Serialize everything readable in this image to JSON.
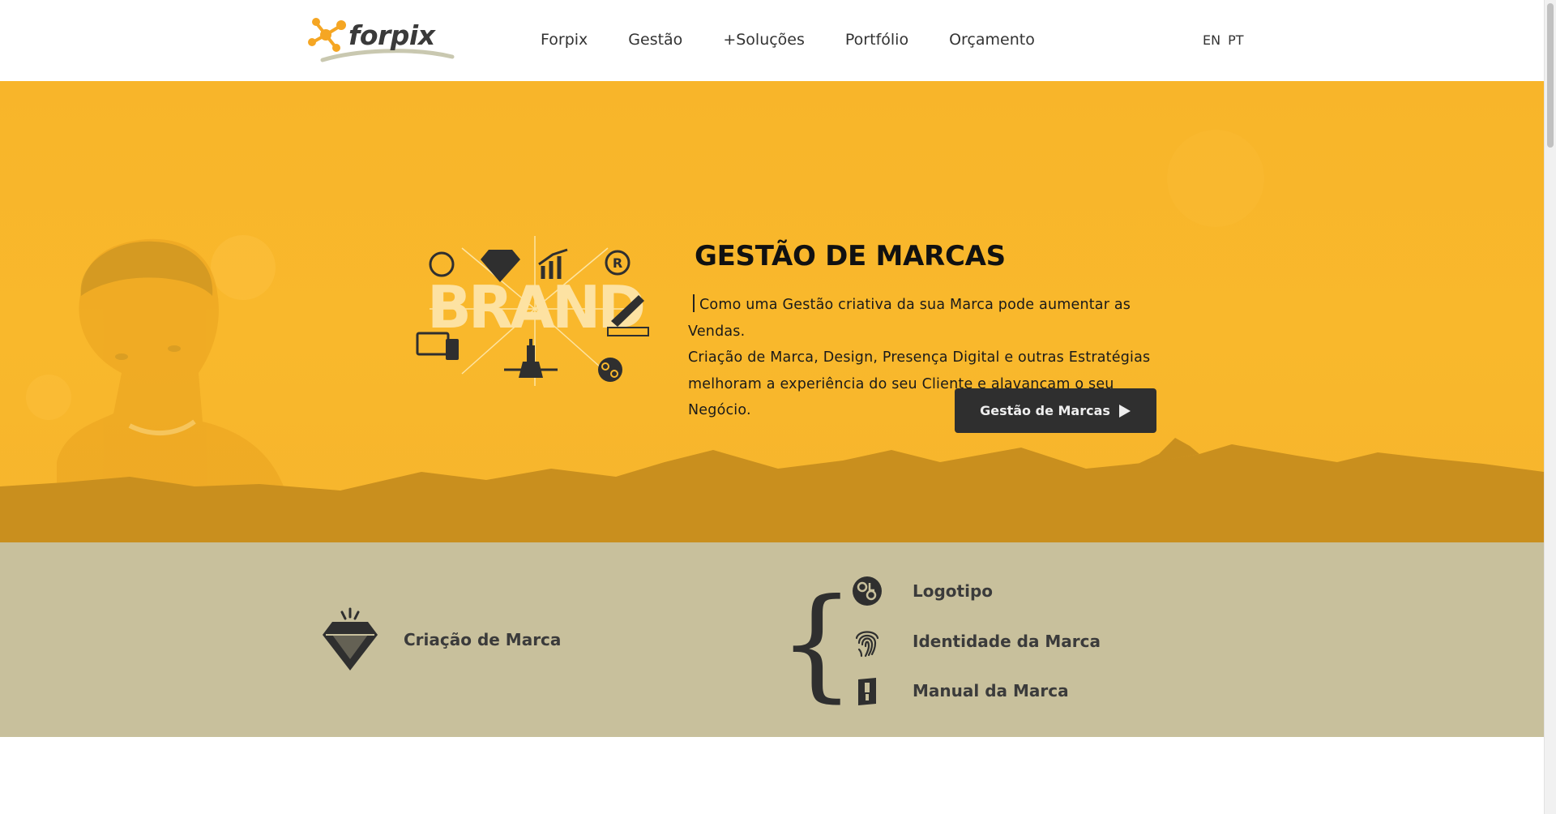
{
  "header": {
    "logo_text": "forpix",
    "nav": [
      "Forpix",
      "Gestão",
      "+Soluções",
      "Portfólio",
      "Orçamento"
    ],
    "languages": [
      "EN",
      "PT"
    ]
  },
  "hero": {
    "art_text": "BRAND",
    "title": "GESTÃO DE MARCAS",
    "description_line1": "Como uma Gestão criativa da sua Marca pode aumentar as Vendas.",
    "description_line2": "Criação de Marca, Design, Presença Digital e outras Estratégias",
    "description_line3": "melhoram a experiência do seu Cliente e alavancam o seu Negócio.",
    "button_label": "Gestão de Marcas"
  },
  "services": {
    "main": "Criação de Marca",
    "sub": [
      "Logotipo",
      "Identidade da Marca",
      "Manual da Marca"
    ]
  },
  "colors": {
    "hero_yellow": "#f9b82c",
    "band_khaki": "#c8c09c",
    "dark": "#2f2f2f",
    "logo_orange": "#f5a623"
  },
  "icons": [
    "logo-molecule-icon",
    "diamond-icon",
    "logo-badge-icon",
    "fingerprint-icon",
    "manual-icon",
    "play-icon"
  ]
}
